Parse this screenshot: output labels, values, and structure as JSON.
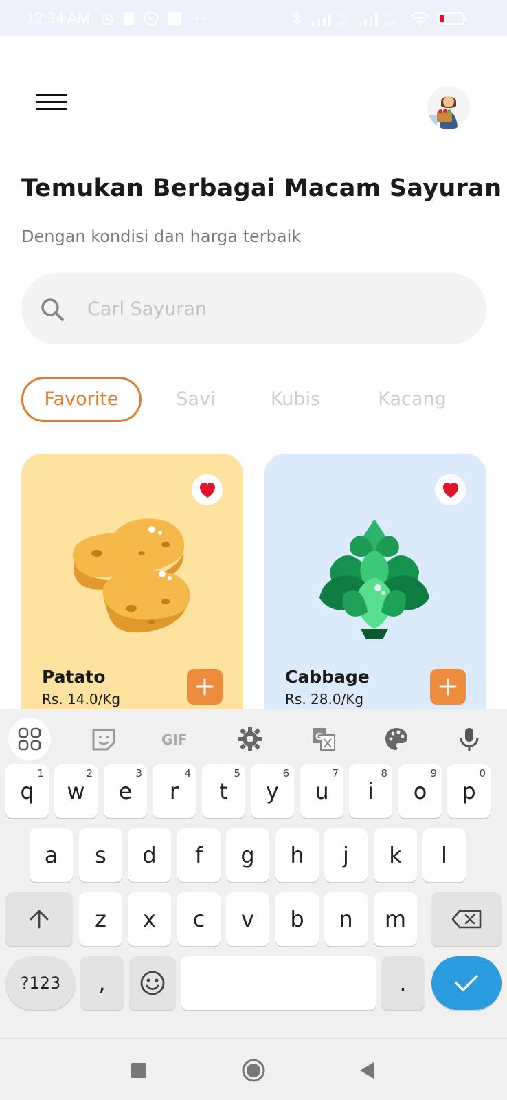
{
  "status_bar": {
    "time": "12:34 AM"
  },
  "header": {
    "title": "Temukan Berbagai Macam Sayuran",
    "subtitle": "Dengan kondisi dan harga terbaik"
  },
  "search": {
    "placeholder": "Carl Sayuran"
  },
  "categories": [
    {
      "label": "Favorite",
      "active": true
    },
    {
      "label": "Savi",
      "active": false
    },
    {
      "label": "Kubis",
      "active": false
    },
    {
      "label": "Kacang",
      "active": false
    }
  ],
  "products": [
    {
      "name": "Patato",
      "price": "Rs. 14.0/Kg",
      "favorite": true,
      "bg_color": "#fde39f"
    },
    {
      "name": "Cabbage",
      "price": "Rs. 28.0/Kg",
      "favorite": true,
      "bg_color": "#dcebfb"
    }
  ],
  "colors": {
    "accent": "#e27c2e",
    "add_button": "#ee8c3e",
    "heart": "#e3122b",
    "keyboard_enter": "#2c9ce0"
  },
  "keyboard": {
    "toolbar": [
      "apps-icon",
      "sticker-icon",
      "gif-icon",
      "settings-icon",
      "translate-icon",
      "palette-icon",
      "mic-icon"
    ],
    "row1": [
      {
        "key": "q",
        "hint": "1"
      },
      {
        "key": "w",
        "hint": "2"
      },
      {
        "key": "e",
        "hint": "3"
      },
      {
        "key": "r",
        "hint": "4"
      },
      {
        "key": "t",
        "hint": "5"
      },
      {
        "key": "y",
        "hint": "6"
      },
      {
        "key": "u",
        "hint": "7"
      },
      {
        "key": "i",
        "hint": "8"
      },
      {
        "key": "o",
        "hint": "9"
      },
      {
        "key": "p",
        "hint": "0"
      }
    ],
    "row2": [
      "a",
      "s",
      "d",
      "f",
      "g",
      "h",
      "j",
      "k",
      "l"
    ],
    "row3": [
      "z",
      "x",
      "c",
      "v",
      "b",
      "n",
      "m"
    ],
    "symbols_label": "?123",
    "comma": ",",
    "period": ".",
    "gif_label": "GIF"
  }
}
